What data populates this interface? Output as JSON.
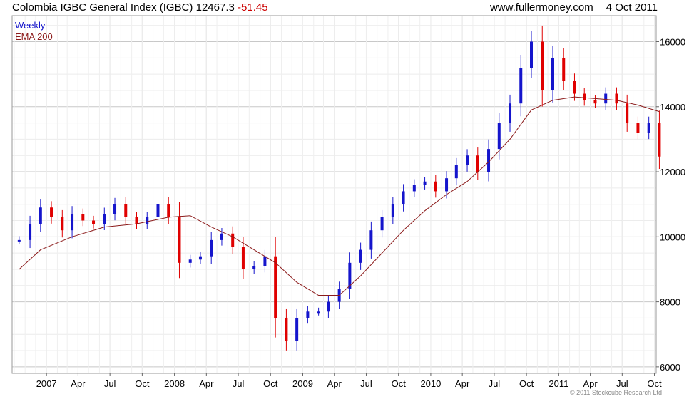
{
  "header": {
    "title": "Colombia IGBC General Index (IGBC)",
    "last": "12467.3",
    "change": "-51.45",
    "site": "www.fullermoney.com",
    "date": "4 Oct 2011"
  },
  "copyright": "© 2011 Stockcube Research Ltd",
  "colors": {
    "up": "#1515cc",
    "down": "#e00000",
    "ema": "#8b1a1a",
    "grid": "#d8d8d8",
    "frame": "#999999"
  },
  "chart_data": {
    "type": "line",
    "title": "Colombia IGBC General Index (IGBC)",
    "legend": [
      "Weekly",
      "EMA 200"
    ],
    "legend_position": "top-left",
    "grid": true,
    "y_axis_side": "right",
    "ylim": [
      5800,
      16800
    ],
    "y_ticks": [
      "6000",
      "8000",
      "10000",
      "12000",
      "14000",
      "16000"
    ],
    "x_ticks": [
      "2007",
      "Apr",
      "Jul",
      "Oct",
      "2008",
      "Apr",
      "Jul",
      "Oct",
      "2009",
      "Apr",
      "Jul",
      "Oct",
      "2010",
      "Apr",
      "Jul",
      "Oct",
      "2011",
      "Apr",
      "Jul",
      "Oct"
    ],
    "series": [
      {
        "name": "Weekly",
        "style": "candlestick",
        "x": [
          "2006-10",
          "2006-11",
          "2006-12",
          "2007-01",
          "2007-02",
          "2007-03",
          "2007-04",
          "2007-05",
          "2007-06",
          "2007-07",
          "2007-08",
          "2007-09",
          "2007-10",
          "2007-11",
          "2007-12",
          "2008-01",
          "2008-02",
          "2008-03",
          "2008-04",
          "2008-05",
          "2008-06",
          "2008-07",
          "2008-08",
          "2008-09",
          "2008-10",
          "2008-11",
          "2008-12",
          "2009-01",
          "2009-02",
          "2009-03",
          "2009-04",
          "2009-05",
          "2009-06",
          "2009-07",
          "2009-08",
          "2009-09",
          "2009-10",
          "2009-11",
          "2009-12",
          "2010-01",
          "2010-02",
          "2010-03",
          "2010-04",
          "2010-05",
          "2010-06",
          "2010-07",
          "2010-08",
          "2010-09",
          "2010-10",
          "2010-11",
          "2010-12",
          "2011-01",
          "2011-02",
          "2011-03",
          "2011-04",
          "2011-05",
          "2011-06",
          "2011-07",
          "2011-08",
          "2011-09",
          "2011-10"
        ],
        "values": [
          9900,
          10400,
          10900,
          10600,
          10200,
          10700,
          10500,
          10400,
          10700,
          11000,
          10600,
          10400,
          10600,
          11000,
          10600,
          9200,
          9300,
          9400,
          9900,
          10100,
          9700,
          9000,
          9100,
          9400,
          7500,
          6800,
          7500,
          7700,
          7700,
          8000,
          8400,
          9200,
          9600,
          10200,
          10600,
          11000,
          11400,
          11600,
          11700,
          11400,
          11800,
          12200,
          12500,
          12000,
          12700,
          13500,
          14100,
          15200,
          16000,
          14500,
          15500,
          14800,
          14400,
          14200,
          14100,
          14400,
          14100,
          13500,
          13200,
          13500,
          12467
        ]
      },
      {
        "name": "EMA 200",
        "style": "line",
        "x": [
          "2006-10",
          "2006-12",
          "2007-03",
          "2007-06",
          "2007-09",
          "2007-12",
          "2008-02",
          "2008-04",
          "2008-06",
          "2008-08",
          "2008-10",
          "2008-12",
          "2009-02",
          "2009-04",
          "2009-06",
          "2009-08",
          "2009-10",
          "2009-12",
          "2010-02",
          "2010-04",
          "2010-06",
          "2010-08",
          "2010-10",
          "2010-12",
          "2011-02",
          "2011-04",
          "2011-06",
          "2011-08",
          "2011-10"
        ],
        "values": [
          9000,
          9600,
          10000,
          10300,
          10400,
          10600,
          10650,
          10300,
          10000,
          9600,
          9200,
          8600,
          8200,
          8200,
          8800,
          9500,
          10200,
          10800,
          11300,
          11700,
          12300,
          13000,
          13900,
          14200,
          14300,
          14250,
          14200,
          14050,
          13850
        ]
      }
    ]
  }
}
